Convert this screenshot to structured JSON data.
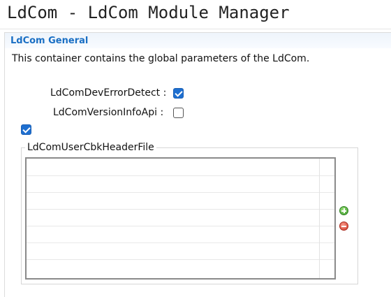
{
  "window": {
    "title": "LdCom - LdCom Module Manager"
  },
  "section": {
    "title": "LdCom General",
    "description": "This container contains the global parameters of the LdCom."
  },
  "params": {
    "dev_error_detect": {
      "label": "LdComDevErrorDetect :",
      "checked": true
    },
    "version_info_api": {
      "label": "LdComVersionInfoApi :",
      "checked": false
    },
    "unlabeled_option": {
      "checked": true
    }
  },
  "user_cbk_header_file": {
    "group_label": "LdComUserCbkHeaderFile",
    "rows": []
  },
  "icons": {
    "add": "add-circle-icon",
    "remove": "remove-circle-icon"
  },
  "colors": {
    "accent": "#1a6fc4",
    "checkbox": "#1e6fd0",
    "add": "#3a9a2a",
    "remove": "#d23a2a"
  }
}
